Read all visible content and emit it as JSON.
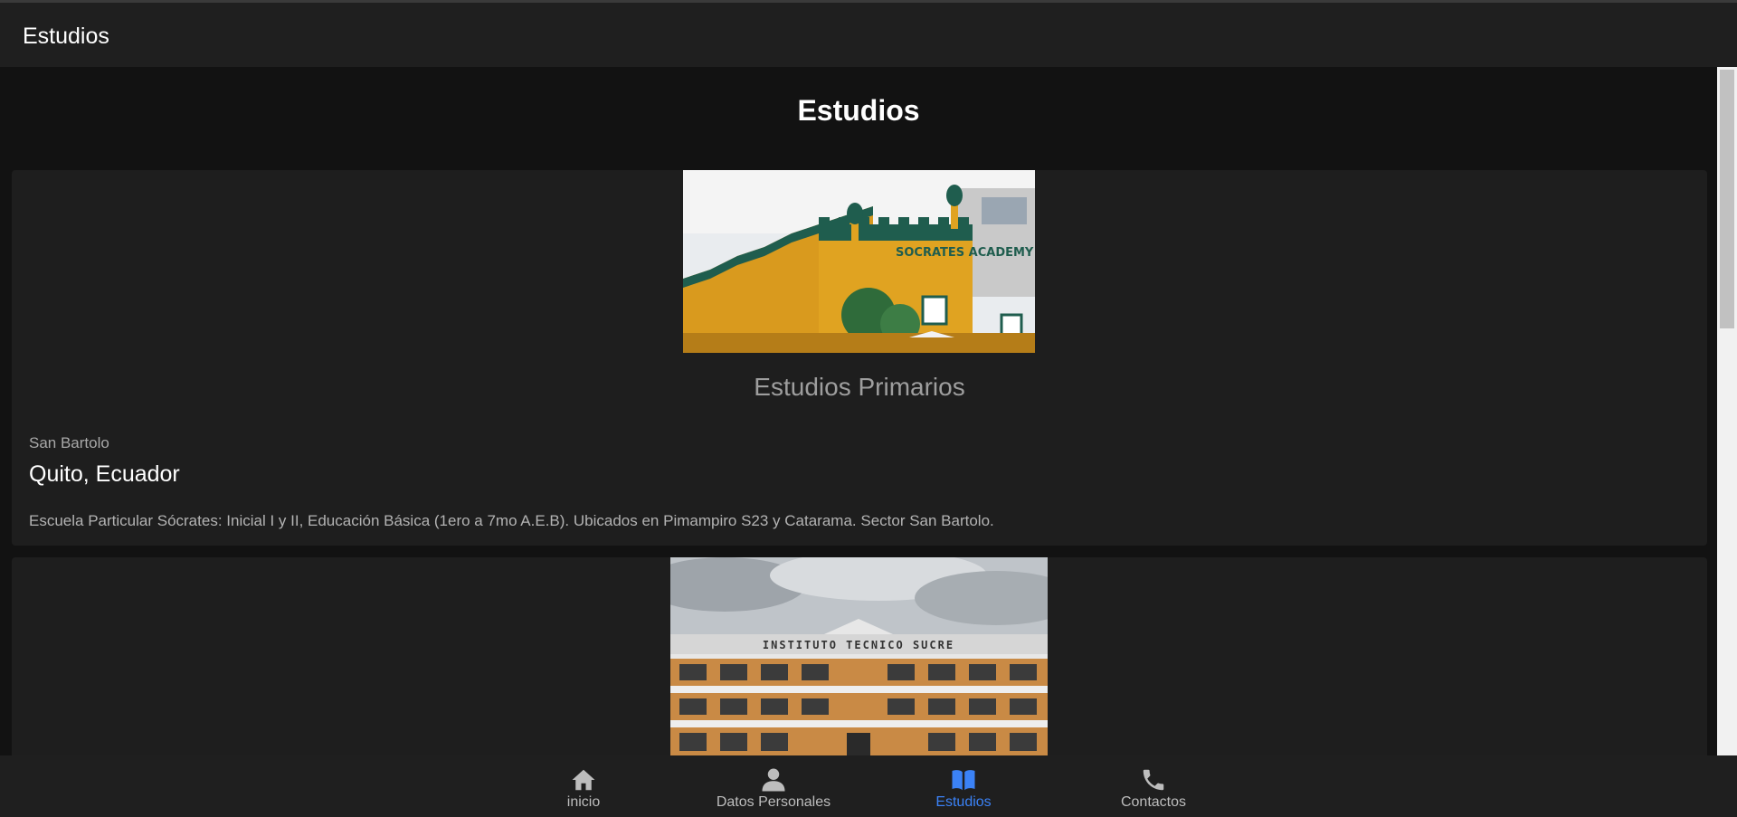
{
  "app": {
    "title": "Estudios"
  },
  "page": {
    "heading": "Estudios"
  },
  "cards": [
    {
      "title": "Estudios Primarios",
      "subtitle": "San Bartolo",
      "place": "Quito, Ecuador",
      "description": "Escuela Particular Sócrates: Inicial I y II, Educación Básica (1ero a 7mo A.E.B). Ubicados en Pimampiro S23 y Catarama. Sector San Bartolo.",
      "image_sign": "SOCRATES ACADEMY"
    },
    {
      "image_sign": "INSTITUTO TECNICO SUCRE"
    }
  ],
  "nav": {
    "items": [
      {
        "label": "inicio",
        "icon": "home-icon"
      },
      {
        "label": "Datos Personales",
        "icon": "person-icon"
      },
      {
        "label": "Estudios",
        "icon": "book-icon",
        "active": true
      },
      {
        "label": "Contactos",
        "icon": "phone-icon"
      }
    ],
    "active_color": "#3b82f6",
    "inactive_color": "#bdbdbd"
  }
}
